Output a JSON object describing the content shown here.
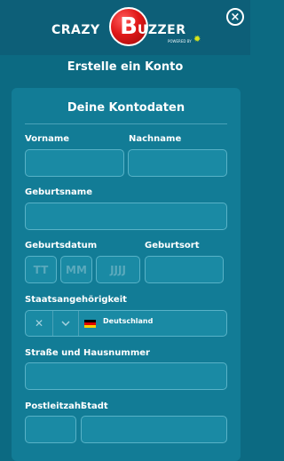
{
  "header": {
    "logo_word_left": "CRAZY",
    "logo_letter": "B",
    "logo_word_right": "UZZER",
    "logo_powered": "POWERED BY",
    "close_icon": "close-icon"
  },
  "page_title": "Erstelle ein Konto",
  "section": {
    "title": "Deine Kontodaten"
  },
  "fields": {
    "vorname_label": "Vorname",
    "nachname_label": "Nachname",
    "geburtsname_label": "Geburtsname",
    "geburtsdatum_label": "Geburtsdatum",
    "geburtsort_label": "Geburtsort",
    "day_placeholder": "TT",
    "month_placeholder": "MM",
    "year_placeholder": "JJJJ",
    "staatsangehoerigkeit_label": "Staatsangehörigkeit",
    "nationality_value": "Deutschland",
    "strasse_label": "Straße und Hausnummer",
    "postleitzahl_label": "Postleitzahl",
    "stadt_label": "Stadt"
  },
  "colors": {
    "background": "#0c6a82",
    "card": "#127c96",
    "input": "#1a8aa4",
    "logo_red": "#e01818",
    "spark": "#d7e51a"
  }
}
